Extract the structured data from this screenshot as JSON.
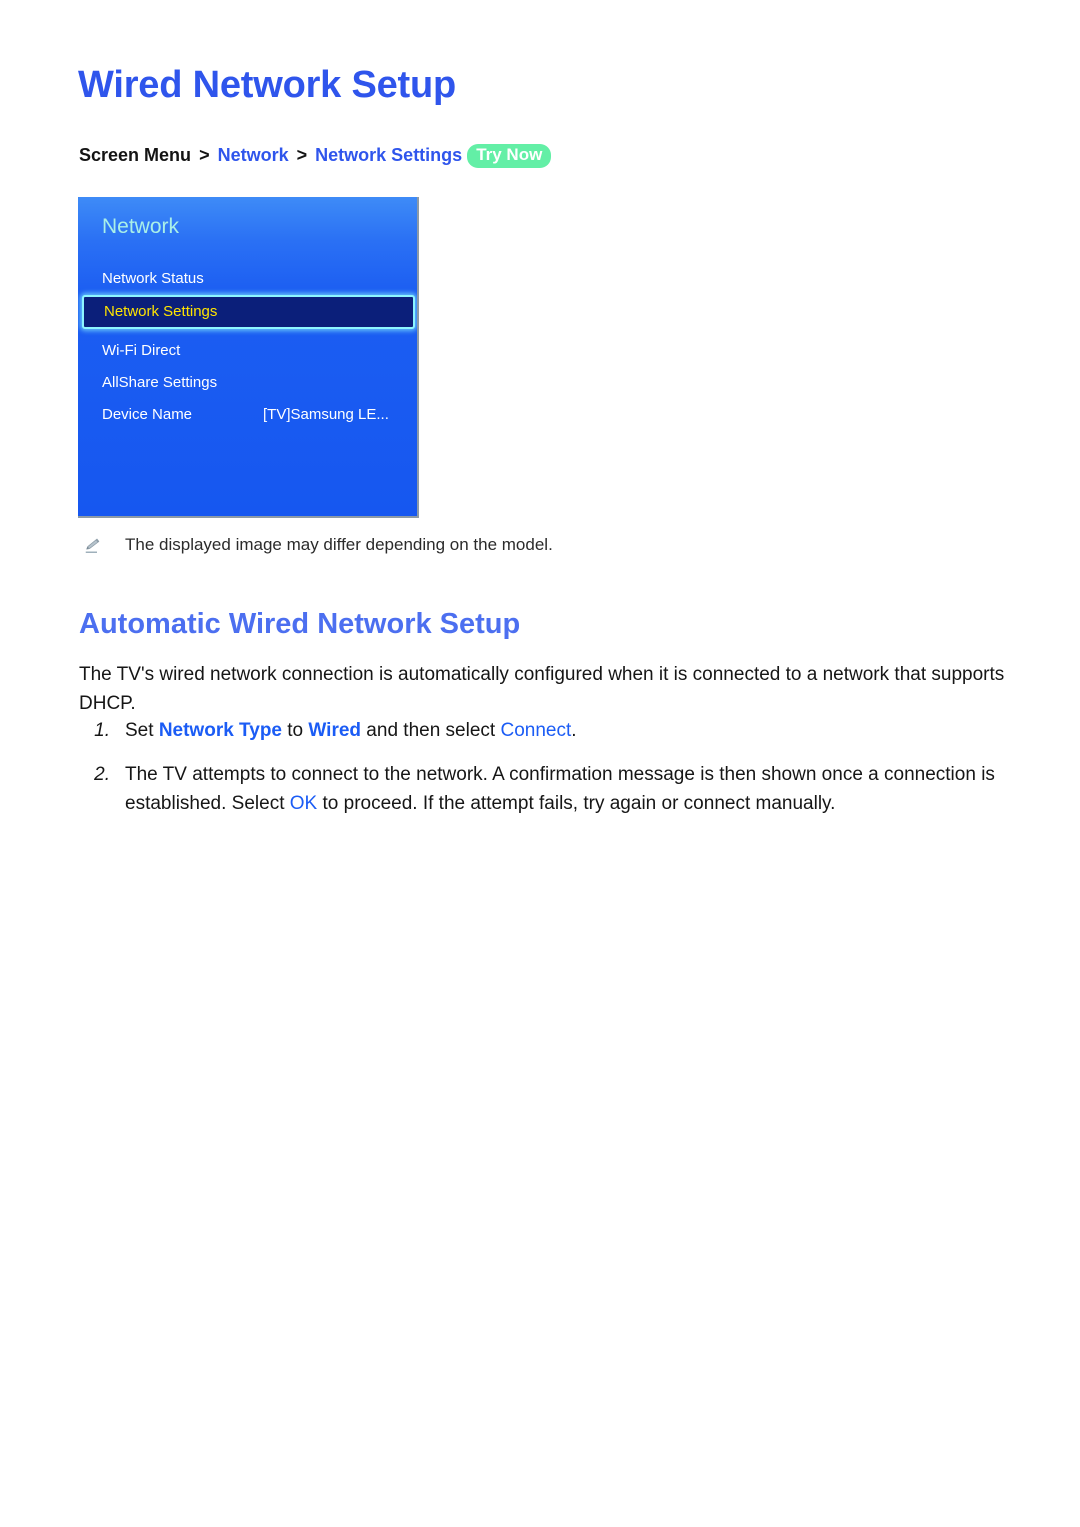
{
  "page": {
    "title": "Wired Network Setup"
  },
  "breadcrumb": {
    "root": "Screen Menu",
    "sep": ">",
    "level1": "Network",
    "level2": "Network Settings",
    "badge": "Try Now",
    "badge_color": "#63efa6"
  },
  "tv_panel": {
    "title": "Network",
    "panel_color": "#1c5ef2",
    "selected_bg": "#0b1f7a",
    "selected_border": "#8df6ff",
    "selected_text": "#ffe400",
    "items": [
      {
        "label": "Network Status",
        "value": "",
        "selected": false
      },
      {
        "label": "Network Settings",
        "value": "",
        "selected": true
      },
      {
        "label": "Wi-Fi Direct",
        "value": "",
        "selected": false
      },
      {
        "label": "AllShare Settings",
        "value": "",
        "selected": false
      },
      {
        "label": "Device Name",
        "value": "[TV]Samsung LE...",
        "selected": false
      }
    ]
  },
  "note": {
    "icon": "pencil-icon",
    "text": "The displayed image may differ depending on the model."
  },
  "section": {
    "heading": "Automatic Wired Network Setup",
    "paragraph": "The TV's wired network connection is automatically configured when it is connected to a network that supports DHCP."
  },
  "steps": [
    {
      "num": "1.",
      "parts": [
        {
          "t": "Set ",
          "style": "plain"
        },
        {
          "t": "Network Type",
          "style": "link-bold"
        },
        {
          "t": " to ",
          "style": "plain"
        },
        {
          "t": "Wired",
          "style": "link-bold"
        },
        {
          "t": " and then select ",
          "style": "plain"
        },
        {
          "t": "Connect",
          "style": "link"
        },
        {
          "t": ".",
          "style": "plain"
        }
      ]
    },
    {
      "num": "2.",
      "parts": [
        {
          "t": "The TV attempts to connect to the network. A confirmation message is then shown once a connection is established. Select ",
          "style": "plain"
        },
        {
          "t": "OK",
          "style": "link"
        },
        {
          "t": " to proceed. If the attempt fails, try again or connect manually.",
          "style": "plain"
        }
      ]
    }
  ]
}
